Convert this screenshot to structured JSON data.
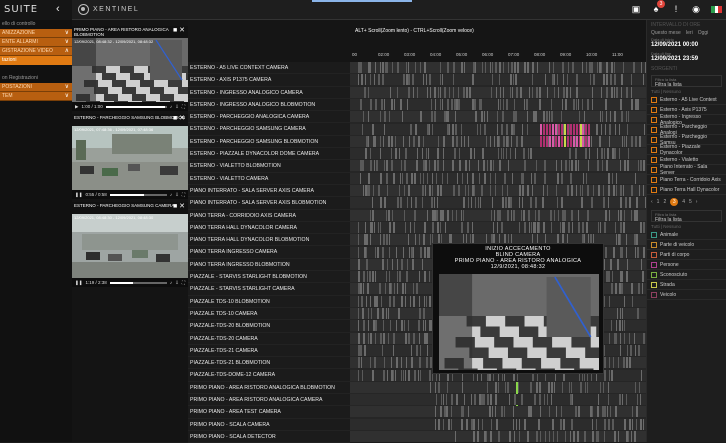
{
  "app": {
    "suite": "SUITE",
    "brand": "XENTINEL",
    "notifications": "3"
  },
  "sidebar": {
    "items": [
      {
        "label": "ello di controllo",
        "style": "dark"
      },
      {
        "label": "ANIZZAZIONE",
        "style": "orange",
        "caret": "∨"
      },
      {
        "label": "ENTE ALLARMI",
        "style": "orange",
        "caret": "∨"
      },
      {
        "label": "GISTRAZIONE VIDEO",
        "style": "orange",
        "caret": "∧"
      },
      {
        "label": "tazioni",
        "style": "active"
      },
      {
        "label": "",
        "style": "dark"
      },
      {
        "label": "on Registrazioni",
        "style": "dark"
      },
      {
        "label": "POSTAZIONI",
        "style": "orange",
        "caret": "∨"
      },
      {
        "label": "TEM",
        "style": "orange",
        "caret": "∨"
      }
    ]
  },
  "videos": [
    {
      "title": "PRIMO PIANO - AREA RISTORO ANALOGICA BLOBMOTION",
      "stamp": "12/09/2021, 08:48:32 - 12/09/2021, 08:48:32",
      "time": "1:00 / 1:00"
    },
    {
      "title": "ESTERNO - PARCHEGGIO SAMSUNG BLOBMOTION",
      "stamp": "12/09/2021, 07:48:36 - 12/09/2021, 07:48:36",
      "time": "0:55 / 0:58"
    },
    {
      "title": "ESTERNO - PARCHEGGIO SAMSUNG CAMERA",
      "stamp": "12/09/2021, 08:48:30 - 12/09/2021, 08:48:30",
      "time": "1:19 / 2:38"
    }
  ],
  "timeline": {
    "hint": "ALT+ Scroll(Zoom lento) - CTRL+Scroll(Zoom veloce)",
    "ticks": [
      "00",
      "02:00",
      "03:00",
      "04:00",
      "05:00",
      "06:00",
      "07:00",
      "08:00",
      "09:00",
      "10:00",
      "11:00"
    ]
  },
  "cameras": [
    "ESTERNO - A5 LIVE CONTEXT CAMERA",
    "ESTERNO - AXIS P1375 CAMERA",
    "ESTERNO - INGRESSO ANALOGICO CAMERA",
    "ESTERNO - INGRESSO ANALOGICO BLOBMOTION",
    "ESTERNO - PARCHEGGIO ANALOGICA CAMERA",
    "ESTERNO - PARCHEGGIO SAMSUNG CAMERA",
    "ESTERNO - PARCHEGGIO SAMSUNG BLOBMOTION",
    "ESTERNO - PIAZZALE DYNACOLOR DOME CAMERA",
    "ESTERNO - VIALETTO BLOBMOTION",
    "ESTERNO - VIALETTO CAMERA",
    "PIANO INTERRATO - SALA SERVER AXIS CAMERA",
    "PIANO INTERRATO - SALA SERVER AXIS BLOBMOTION",
    "PIANO TERRA - CORRIDOIO AXIS CAMERA",
    "PIANO TERRA HALL DYNACOLOR CAMERA",
    "PIANO TERRA HALL DYNACOLOR BLOBMOTION",
    "PIANO TERRA INGRESSO CAMERA",
    "PIANO TERRA INGRESSO BLOBMOTION",
    "PIAZZALE - STARVIS STARLIGHT BLOBMOTION",
    "PIAZZALE - STARVIS STARLIGHT CAMERA",
    "PIAZZALE TDS-10 BLOBMOTION",
    "PIAZZALE TDS-10 CAMERA",
    "PIAZZALE-TDS-20 BLOBMOTION",
    "PIAZZALE-TDS-20 CAMERA",
    "PIAZZALE-TDS-21 CAMERA",
    "PIAZZALE-TDS-21 BLOBMOTION",
    "PIAZZALE-TDS-DOME-12 CAMERA",
    "PRIMO PIANO - AREA RISTORO ANALOGICA BLOBMOTION",
    "PRIMO PIANO - AREA RISTORO ANALOGICA CAMERA",
    "PRIMO PIANO - AREA TEST CAMERA",
    "PRIMO PIANO - SCALA CAMERA",
    "PRIMO PIANO - SCALA DETECTOR"
  ],
  "popup": {
    "line1": "INIZIO ACCECAMENTO",
    "line2": "BLIND CAMERA",
    "line3": "PRIMO PIANO - AREA RISTORO ANALOGICA",
    "line4": "12/9/2021, 08:48:32"
  },
  "right": {
    "title": "INTERVALLO DI ORE",
    "tabs": [
      "Questo mese",
      "Ieri",
      "Oggi"
    ],
    "from_label": "Data di inizio",
    "from": "12/09/2021 00:00",
    "to_label": "Data di fine",
    "to": "12/09/2021 23:59",
    "section": "SORGENTI",
    "filter_label": "Filtra la lista",
    "filter_placeholder": "Filtra la lista",
    "select": [
      "Tutti",
      "Nessuno"
    ],
    "sources": [
      "Esterno - A5 Live Context",
      "Esterno - Axis P1375",
      "Esterno - Ingresso Analogico",
      "Esterno - Parcheggio Analogi",
      "Esterno - Parcheggio Samsu",
      "Esterno - Piazzale Dynacolor",
      "Esterno - Vialetto",
      "Piano Interrato - Sala Server",
      "Piano Terra - Corridoio Axis",
      "Piano Terra Hall Dynacolor"
    ],
    "pages": [
      "‹",
      "1",
      "2",
      "3",
      "4",
      "5",
      "›"
    ],
    "classes": [
      "Animale",
      "Parte di veicolo",
      "Parti di corpo",
      "Persone",
      "Sconosciuto",
      "Strada",
      "Veicolo"
    ]
  }
}
